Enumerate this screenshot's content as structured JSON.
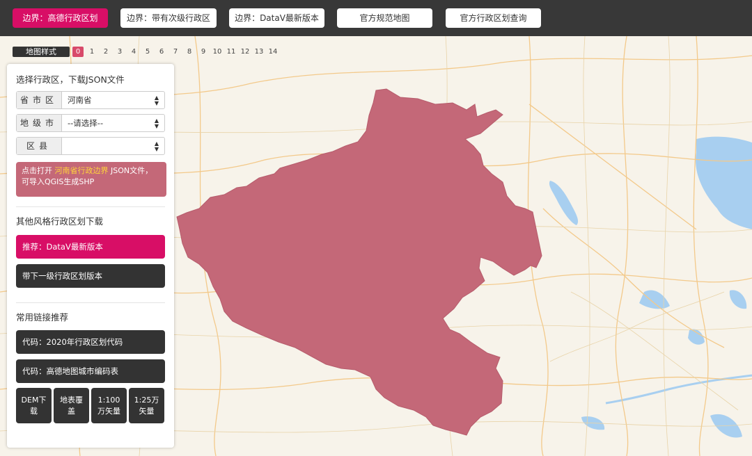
{
  "top_nav": [
    {
      "label": "边界：高德行政区划",
      "active": true
    },
    {
      "label": "边界：带有次级行政区",
      "active": false
    },
    {
      "label": "边界：DataV最新版本",
      "active": false
    },
    {
      "label": "官方规范地图",
      "active": false
    },
    {
      "label": "官方行政区划查询",
      "active": false
    }
  ],
  "map_style": {
    "label": "地图样式",
    "options": [
      "0",
      "1",
      "2",
      "3",
      "4",
      "5",
      "6",
      "7",
      "8",
      "9",
      "10",
      "11",
      "12",
      "13",
      "14"
    ],
    "selected": "0"
  },
  "panel": {
    "select_title": "选择行政区，下载JSON文件",
    "province": {
      "label": "省市区",
      "value": "河南省"
    },
    "city": {
      "label": "地级市",
      "value": "--请选择--"
    },
    "district": {
      "label": "区县",
      "value": ""
    },
    "download_notice": {
      "prefix": "点击打开 ",
      "highlight": "河南省行政边界",
      "suffix": " JSON文件，",
      "line2": "可导入QGIS生成SHP"
    },
    "other_title": "其他风格行政区划下载",
    "datav_button": "推荐：DataV最新版本",
    "sub_level_button": "带下一级行政区划版本",
    "links_title": "常用链接推荐",
    "code_2020_button": "代码：2020年行政区划代码",
    "amap_code_button": "代码：高德地图城市编码表",
    "small_buttons": [
      "DEM下载",
      "地表覆盖",
      "1:100万矢量",
      "1:25万矢量"
    ]
  },
  "colors": {
    "topbar_bg": "#383838",
    "accent_pink": "#d80e66",
    "region_fill": "#c46878",
    "dark_button": "#333333",
    "highlight_text": "#ffd43b",
    "map_bg": "#f7f3ea",
    "water": "#a8cff0"
  }
}
